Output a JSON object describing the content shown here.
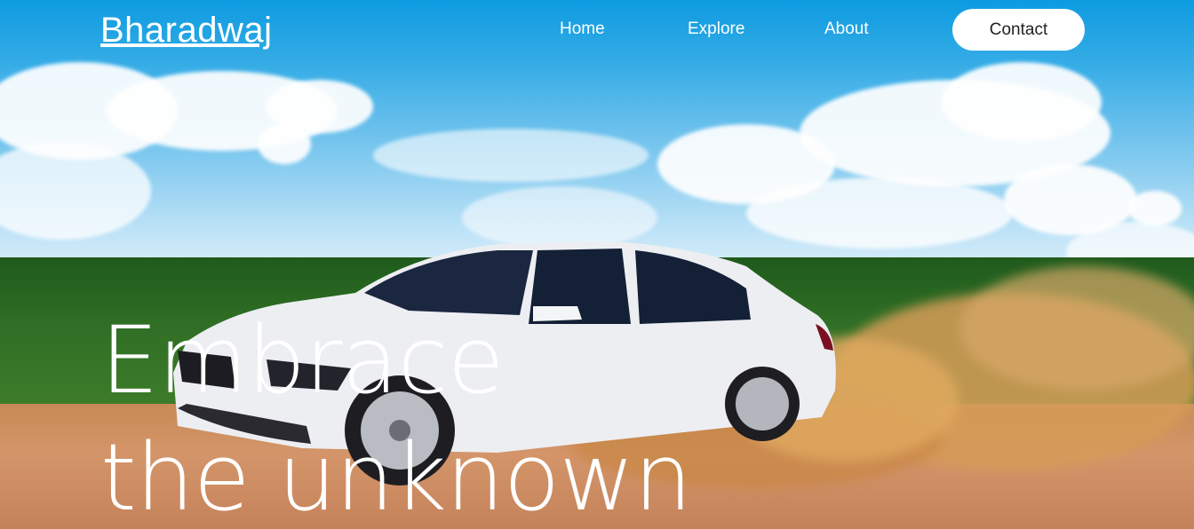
{
  "brand": {
    "name": "Bharadwaj"
  },
  "nav": {
    "links": [
      {
        "label": "Home"
      },
      {
        "label": "Explore"
      },
      {
        "label": "About"
      }
    ],
    "cta_label": "Contact"
  },
  "hero": {
    "headline_line1": "Embrace",
    "headline_line2": "the unknown",
    "background_image": "white sedan drifting on dirt road kicking up orange dust under blue sky with clouds"
  },
  "colors": {
    "sky_top": "#0d9be0",
    "text": "#ffffff",
    "button_bg": "#ffffff",
    "button_text": "#222222",
    "dust": "#d9a05a"
  }
}
